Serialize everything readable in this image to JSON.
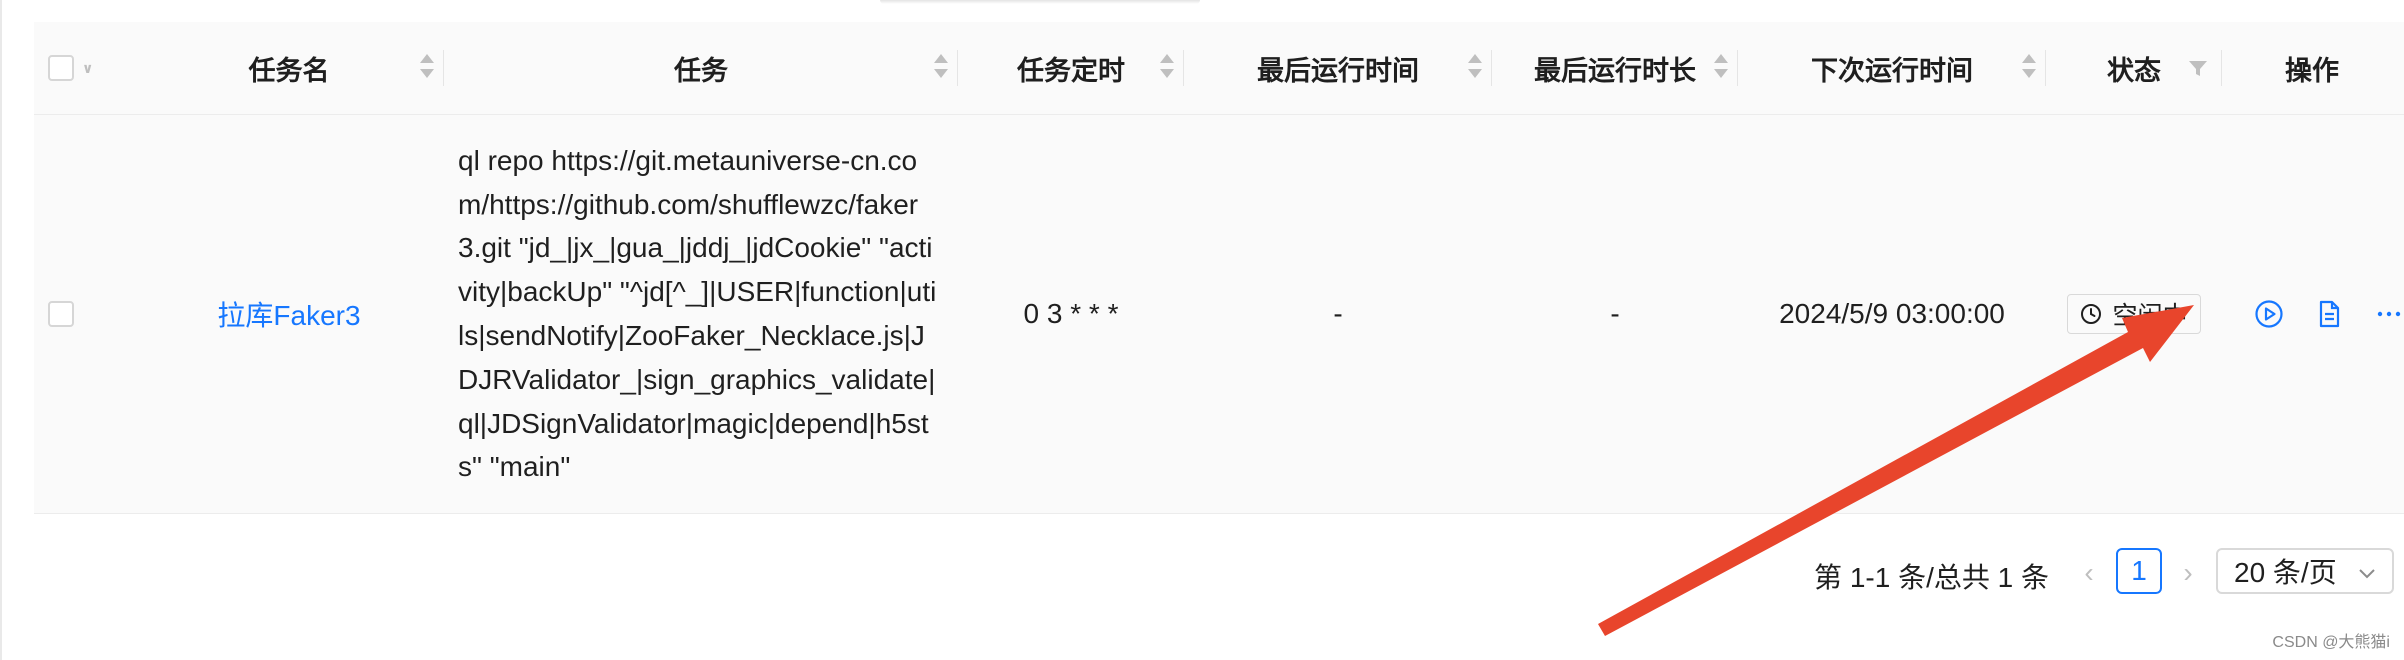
{
  "table": {
    "columns": [
      {
        "key": "name",
        "label": "任务名",
        "sortable": true
      },
      {
        "key": "command",
        "label": "任务",
        "sortable": true
      },
      {
        "key": "schedule",
        "label": "任务定时",
        "sortable": true
      },
      {
        "key": "last_run_time",
        "label": "最后运行时间",
        "sortable": true
      },
      {
        "key": "last_run_duration",
        "label": "最后运行时长",
        "sortable": true
      },
      {
        "key": "next_run_time",
        "label": "下次运行时间",
        "sortable": true
      },
      {
        "key": "status",
        "label": "状态",
        "filterable": true
      },
      {
        "key": "actions",
        "label": "操作"
      }
    ],
    "rows": [
      {
        "name": "拉库Faker3",
        "command": "ql repo https://git.metauniverse-cn.com/https://github.com/shufflewzc/faker3.git \"jd_|jx_|gua_|jddj_|jdCookie\" \"activity|backUp\" \"^jd[^_]|USER|function|utils|sendNotify|ZooFaker_Necklace.js|JDJRValidator_|sign_graphics_validate|ql|JDSignValidator|magic|depend|h5sts\" \"main\"",
        "schedule": "0 3 * * *",
        "last_run_time": "-",
        "last_run_duration": "-",
        "next_run_time": "2024/5/9 03:00:00",
        "status": "空闲中",
        "status_icon": "clock-icon",
        "actions": [
          "play-circle-icon",
          "file-text-icon",
          "more-icon"
        ]
      }
    ]
  },
  "pagination": {
    "total_text": "第 1-1 条/总共 1 条",
    "current_page": "1",
    "page_size": "20 条/页"
  },
  "watermark": "CSDN @大熊猫i",
  "colors": {
    "accent": "#1677ff",
    "arrow": "#e8452c",
    "header_bg": "#fafafa"
  }
}
